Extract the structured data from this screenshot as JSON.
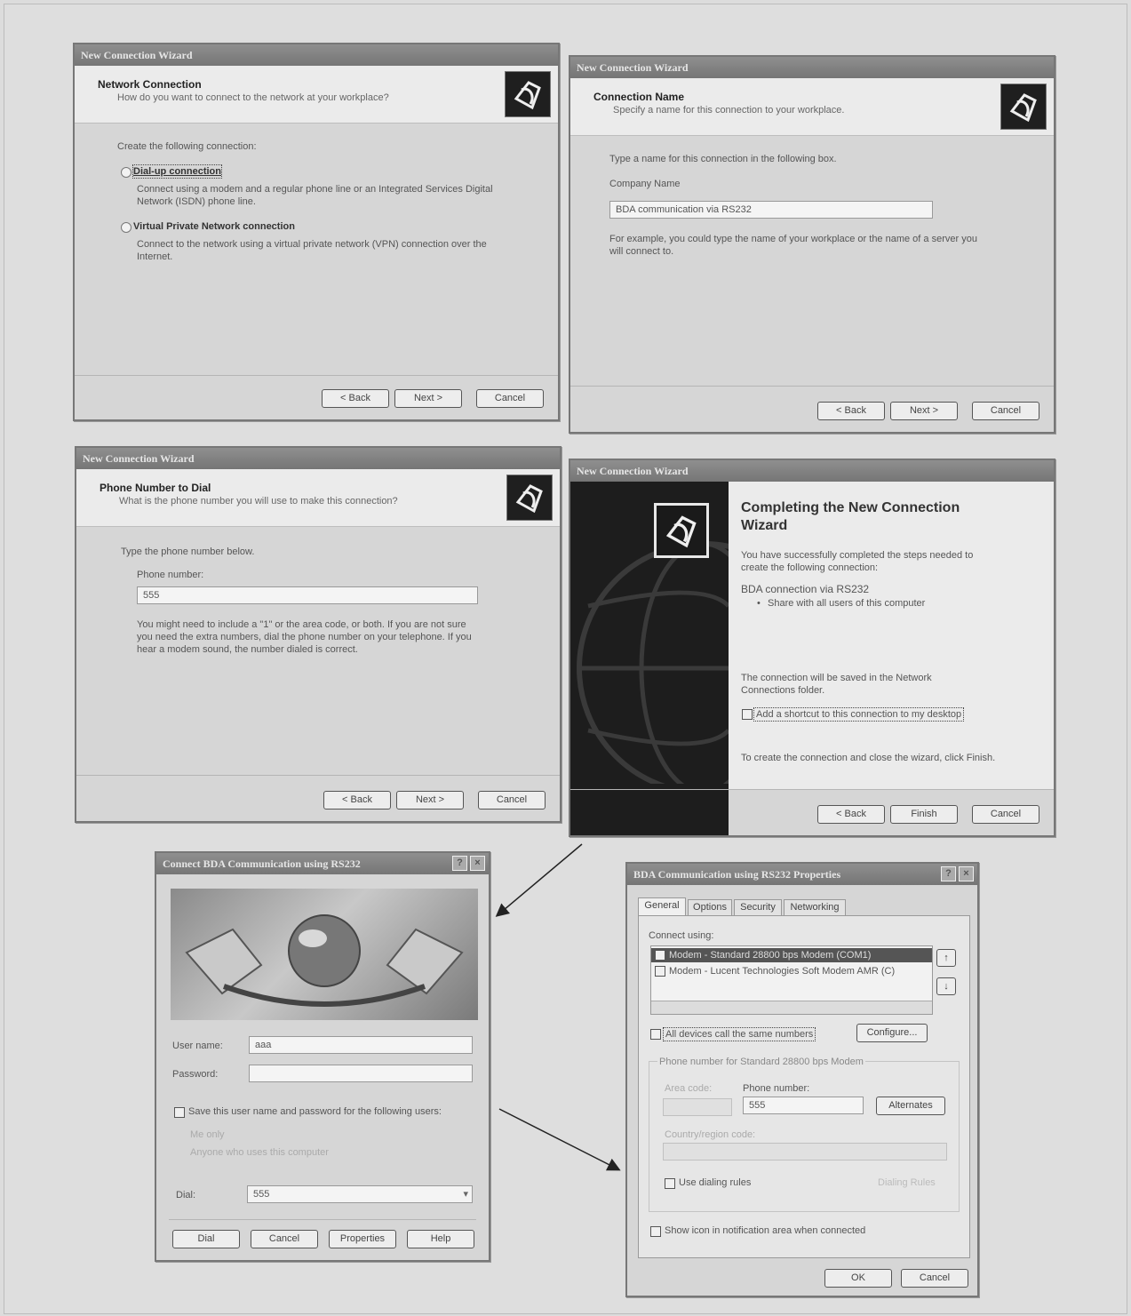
{
  "w1": {
    "title": "New Connection Wizard",
    "heading": "Network Connection",
    "subheading": "How do you want to connect to the network at your workplace?",
    "prompt": "Create the following connection:",
    "option1_label": "Dial-up connection",
    "option1_desc_1": "Connect using a modem and a regular phone line or an Integrated Services Digital",
    "option1_desc_2": "Network (ISDN) phone line.",
    "option2_label": "Virtual Private Network connection",
    "option2_desc_1": "Connect to the network using a virtual private network (VPN) connection over the",
    "option2_desc_2": "Internet.",
    "back": "< Back",
    "next": "Next >",
    "cancel": "Cancel"
  },
  "w2": {
    "title": "New Connection Wizard",
    "heading": "Connection Name",
    "subheading": "Specify a name for this connection to your workplace.",
    "prompt": "Type a name for this connection in the following box.",
    "field_label": "Company Name",
    "field_value": "BDA communication via RS232",
    "example_1": "For example, you could type the name of your workplace or the name of a server you",
    "example_2": "will connect to.",
    "back": "< Back",
    "next": "Next >",
    "cancel": "Cancel"
  },
  "w3": {
    "title": "New Connection Wizard",
    "heading": "Phone Number to Dial",
    "subheading": "What is the phone number you will use to make this connection?",
    "prompt": "Type the phone number below.",
    "field_label": "Phone number:",
    "field_value": "555",
    "note_1": "You might need to include a \"1\" or the area code, or both. If you are not sure",
    "note_2": "you need the extra numbers, dial the phone number on your telephone. If you",
    "note_3": "hear a modem sound, the number dialed is correct.",
    "back": "< Back",
    "next": "Next >",
    "cancel": "Cancel"
  },
  "w4": {
    "title": "New Connection Wizard",
    "heading_1": "Completing the New Connection",
    "heading_2": "Wizard",
    "success_1": "You have successfully completed the steps needed to",
    "success_2": "create the following connection:",
    "conn_name": "BDA connection via RS232",
    "bullet": "Share with all users of this computer",
    "saved_1": "The connection will be saved in the Network",
    "saved_2": "Connections folder.",
    "shortcut": "Add a shortcut to this connection to my desktop",
    "finish_note": "To create the connection and close the wizard, click Finish.",
    "back": "< Back",
    "finish": "Finish",
    "cancel": "Cancel"
  },
  "w5": {
    "title": "Connect BDA Communication using RS232",
    "user_label": "User name:",
    "user_value": "aaa",
    "password_label": "Password:",
    "save_label": "Save this user name and password for the following users:",
    "opt_me": "Me only",
    "opt_anyone": "Anyone who uses this computer",
    "dial_label": "Dial:",
    "dial_value": "555",
    "btn_dial": "Dial",
    "btn_cancel": "Cancel",
    "btn_properties": "Properties",
    "btn_help": "Help"
  },
  "w6": {
    "title": "BDA Communication using RS232 Properties",
    "tabs": [
      "General",
      "Options",
      "Security",
      "Networking"
    ],
    "connect_using": "Connect using:",
    "device_1": "Modem - Standard 28800 bps Modem (COM1)",
    "device_2": "Modem - Lucent Technologies Soft Modem AMR (C)",
    "all_devices": "All devices call the same numbers",
    "configure": "Configure...",
    "phone_group": "Phone number for Standard 28800 bps Modem",
    "area_code": "Area code:",
    "phone_label": "Phone number:",
    "phone_value": "555",
    "alternates": "Alternates",
    "country_code": "Country/region code:",
    "dialing_rules": "Use dialing rules",
    "dialing_btn": "Dialing Rules",
    "show_icon": "Show icon in notification area when connected",
    "ok": "OK",
    "cancel": "Cancel"
  }
}
